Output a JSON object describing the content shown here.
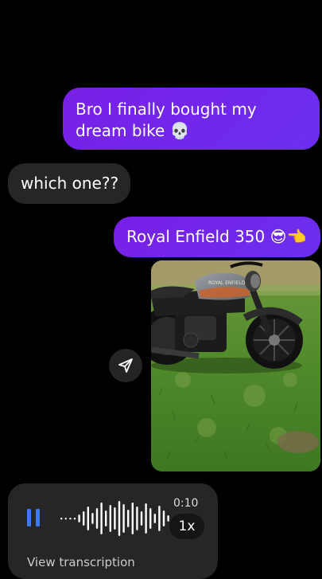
{
  "messages": {
    "m1": {
      "text": "Bro I finally bought my dream bike 💀"
    },
    "m2": {
      "text": "which one??"
    },
    "m3": {
      "text": "Royal Enfield 350 😎👈"
    }
  },
  "photo": {
    "tank_text": "ROYAL ENFIELD"
  },
  "share": {
    "icon": "send-icon"
  },
  "voice": {
    "state": "playing",
    "progress": 0.0,
    "duration": "0:10",
    "speed": "1x",
    "transcription_link": "View transcription"
  },
  "colors": {
    "sent_bubble": "#7a1fe6",
    "received_bubble": "#262626",
    "accent": "#3d79f2"
  }
}
